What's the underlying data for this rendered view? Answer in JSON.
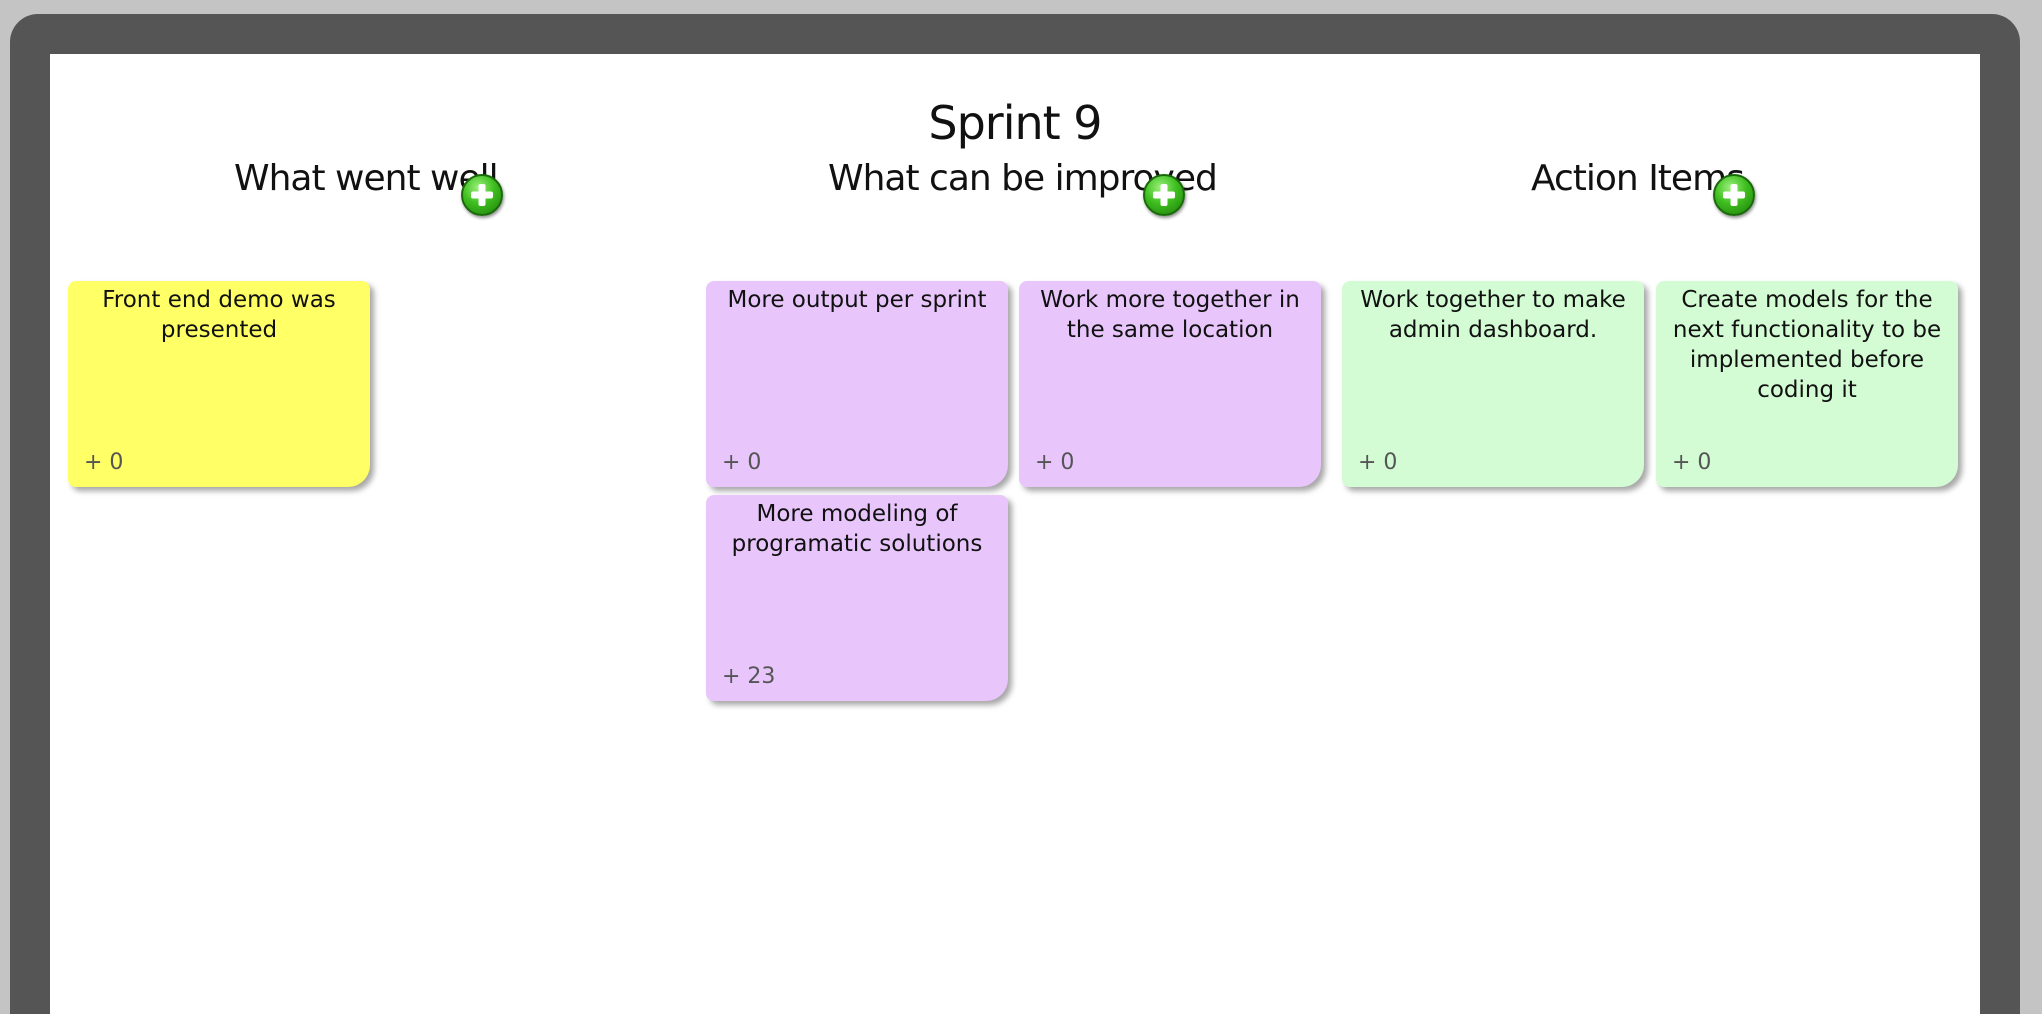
{
  "board": {
    "title": "Sprint 9"
  },
  "columns": [
    {
      "title": "What went well",
      "color": "#ffff66"
    },
    {
      "title": "What can be improved",
      "color": "#e8c6fc"
    },
    {
      "title": "Action Items",
      "color": "#d4fcd4"
    }
  ],
  "add_icon": "plus-circle-icon",
  "cards": {
    "well": [
      {
        "text": "Front end demo was presented",
        "votes": "+ 0"
      }
    ],
    "improved": [
      {
        "text": "More output per sprint",
        "votes": "+ 0"
      },
      {
        "text": "Work more together in the same location",
        "votes": "+ 0"
      },
      {
        "text": "More modeling of programatic solutions",
        "votes": "+ 23"
      }
    ],
    "actions": [
      {
        "text": "Work together to make admin dashboard.",
        "votes": "+ 0"
      },
      {
        "text": "Create models for the next functionality to be implemented before coding it",
        "votes": "+ 0"
      }
    ]
  }
}
